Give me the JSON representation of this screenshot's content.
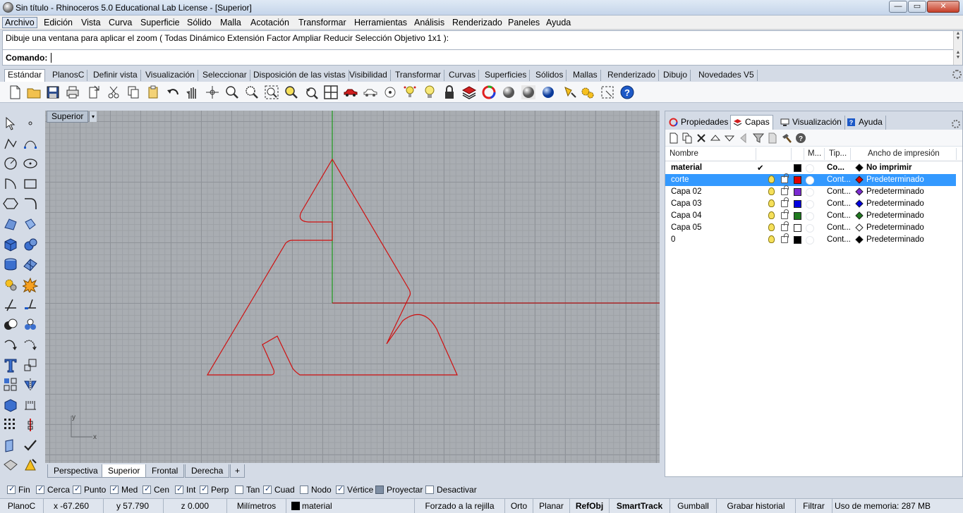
{
  "window": {
    "title": "Sin título - Rhinoceros 5.0 Educational Lab License - [Superior]",
    "min_label": "—",
    "max_label": "▭",
    "close_label": "✕"
  },
  "menu": [
    "Archivo",
    "Edición",
    "Vista",
    "Curva",
    "Superficie",
    "Sólido",
    "Malla",
    "Acotación",
    "Transformar",
    "Herramientas",
    "Análisis",
    "Renderizado",
    "Paneles",
    "Ayuda"
  ],
  "command": {
    "history": "Dibuje una ventana para aplicar el zoom ( Todas  Dinámico  Extensión  Factor  Ampliar  Reducir  Selección  Objetivo  1x1 ):",
    "prompt_label": "Comando:",
    "value": ""
  },
  "toolbar_tabs": [
    "Estándar",
    "PlanosC",
    "Definir vista",
    "Visualización",
    "Seleccionar",
    "Disposición de las vistas",
    "Visibilidad",
    "Transformar",
    "Curvas",
    "Superficies",
    "Sólidos",
    "Mallas",
    "Renderizado",
    "Dibujo",
    "Novedades V5"
  ],
  "toolbar_tabs_active": "Estándar",
  "viewport": {
    "name": "Superior",
    "dropdown_glyph": "▾",
    "axis_x": "x",
    "axis_y": "y"
  },
  "viewport_tabs": [
    "Perspectiva",
    "Superior",
    "Frontal",
    "Derecha"
  ],
  "viewport_tabs_active": "Superior",
  "viewport_add_glyph": "+",
  "panel": {
    "tabs": [
      "Propiedades",
      "Capas",
      "Visualización",
      "Ayuda"
    ],
    "active_tab": "Capas",
    "columns": {
      "name": "Nombre",
      "material": "M...",
      "linetype": "Tip...",
      "print_width": "Ancho de impresión"
    },
    "layers": [
      {
        "name": "material",
        "current": true,
        "current_mark": "✔",
        "linetype": "Co...",
        "print_width": "No imprimir",
        "color": "#000000",
        "selected": false
      },
      {
        "name": "corte",
        "current": false,
        "current_mark": "",
        "linetype": "Cont...",
        "print_width": "Predeterminado",
        "color": "#e00000",
        "selected": true
      },
      {
        "name": "Capa 02",
        "current": false,
        "current_mark": "",
        "linetype": "Cont...",
        "print_width": "Predeterminado",
        "color": "#7b2bd0",
        "selected": false
      },
      {
        "name": "Capa 03",
        "current": false,
        "current_mark": "",
        "linetype": "Cont...",
        "print_width": "Predeterminado",
        "color": "#0000e0",
        "selected": false
      },
      {
        "name": "Capa 04",
        "current": false,
        "current_mark": "",
        "linetype": "Cont...",
        "print_width": "Predeterminado",
        "color": "#1f7a1f",
        "selected": false
      },
      {
        "name": "Capa 05",
        "current": false,
        "current_mark": "",
        "linetype": "Cont...",
        "print_width": "Predeterminado",
        "color": "#ffffff",
        "selected": false
      },
      {
        "name": "0",
        "current": false,
        "current_mark": "",
        "linetype": "Cont...",
        "print_width": "Predeterminado",
        "color": "#000000",
        "selected": false
      }
    ]
  },
  "osnaps": [
    {
      "label": "Fin",
      "checked": true
    },
    {
      "label": "Cerca",
      "checked": true
    },
    {
      "label": "Punto",
      "checked": true
    },
    {
      "label": "Med",
      "checked": true
    },
    {
      "label": "Cen",
      "checked": true
    },
    {
      "label": "Int",
      "checked": true
    },
    {
      "label": "Perp",
      "checked": true
    },
    {
      "label": "Tan",
      "checked": false
    },
    {
      "label": "Cuad",
      "checked": true
    },
    {
      "label": "Nodo",
      "checked": false
    },
    {
      "label": "Vértice",
      "checked": true
    },
    {
      "label": "Proyectar",
      "checked": false,
      "style": "project"
    },
    {
      "label": "Desactivar",
      "checked": false
    }
  ],
  "status": {
    "cplane": "PlanoC",
    "x": "x -67.260",
    "y": "y 57.790",
    "z": "z 0.000",
    "units": "Milímetros",
    "layer": "material",
    "layer_color": "#000000",
    "grid_snap": "Forzado a la rejilla",
    "ortho": "Orto",
    "planar": "Planar",
    "osnap": "RefObj",
    "smarttrack": "SmartTrack",
    "gumball": "Gumball",
    "history": "Grabar historial",
    "filter": "Filtrar",
    "memory": "Uso de memoria: 287 MB"
  },
  "colors": {
    "curve": "#d01010",
    "x_axis": "#b01010",
    "y_axis": "#1e9a1e",
    "selection": "#3399ff"
  }
}
